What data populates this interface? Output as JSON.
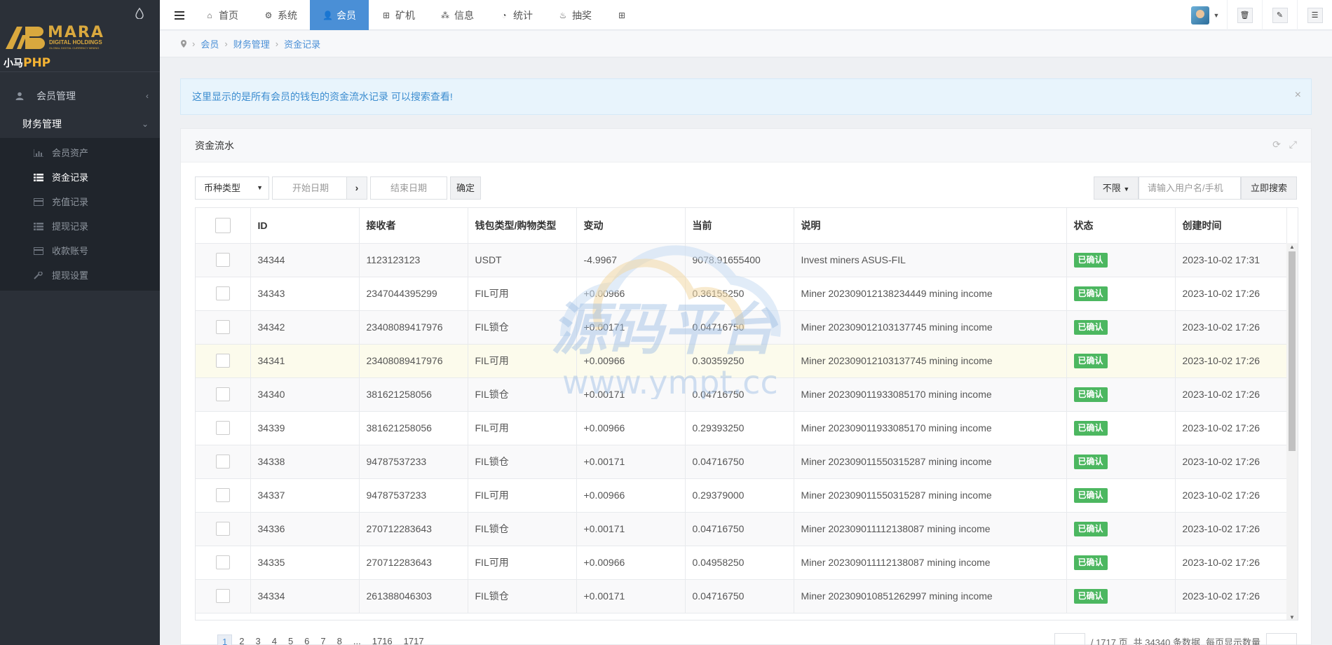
{
  "brand": {
    "logo_name": "MARA",
    "logo_sub": "DIGITAL HOLDINGS",
    "logo_sub2": "GLOBAL DIGITAL CURRENCY MINING",
    "product_prefix": "小马",
    "product_suffix": "PHP"
  },
  "sidebar": {
    "items": [
      {
        "label": "会员管理",
        "icon": "user-icon",
        "chevron": "‹"
      },
      {
        "label": "财务管理",
        "icon": "finance-icon",
        "chevron": "⌄"
      }
    ],
    "sub_items": [
      {
        "label": "会员资产",
        "icon": "bar-chart-icon"
      },
      {
        "label": "资金记录",
        "icon": "list-icon"
      },
      {
        "label": "充值记录",
        "icon": "card-icon"
      },
      {
        "label": "提现记录",
        "icon": "list-icon"
      },
      {
        "label": "收款账号",
        "icon": "card-icon"
      },
      {
        "label": "提现设置",
        "icon": "wrench-icon"
      }
    ]
  },
  "topnav": {
    "tabs": [
      {
        "label": "首页",
        "icon": "⌂"
      },
      {
        "label": "系统",
        "icon": "⚙"
      },
      {
        "label": "会员",
        "icon": "👤"
      },
      {
        "label": "矿机",
        "icon": "⊞"
      },
      {
        "label": "信息",
        "icon": "⁂"
      },
      {
        "label": "统计",
        "icon": "◔"
      },
      {
        "label": "抽奖",
        "icon": "♨"
      },
      {
        "label": "",
        "icon": "⊞"
      }
    ]
  },
  "breadcrumb": [
    "会员",
    "财务管理",
    "资金记录"
  ],
  "alert": {
    "text": "这里显示的是所有会员的钱包的资金流水记录 可以搜索查看!",
    "close": "×"
  },
  "panel": {
    "title": "资金流水",
    "filters": {
      "currency_select": "币种类型",
      "start_date_placeholder": "开始日期",
      "end_date_placeholder": "结束日期",
      "arrow": "›",
      "confirm": "确定",
      "scope_select": "不限",
      "search_placeholder": "请输入用户名/手机",
      "search_button": "立即搜索"
    },
    "columns": [
      "ID",
      "接收者",
      "钱包类型/购物类型",
      "变动",
      "当前",
      "说明",
      "状态",
      "创建时间"
    ],
    "rows": [
      [
        "34344",
        "1123123123",
        "USDT",
        "-4.9967",
        "9078.91655400",
        "Invest miners ASUS-FIL",
        "已确认",
        "2023-10-02 17:31"
      ],
      [
        "34343",
        "2347044395299",
        "FIL可用",
        "+0.00966",
        "0.36155250",
        "Miner 202309012138234449 mining income",
        "已确认",
        "2023-10-02 17:26"
      ],
      [
        "34342",
        "23408089417976",
        "FIL锁仓",
        "+0.00171",
        "0.04716750",
        "Miner 202309012103137745 mining income",
        "已确认",
        "2023-10-02 17:26"
      ],
      [
        "34341",
        "23408089417976",
        "FIL可用",
        "+0.00966",
        "0.30359250",
        "Miner 202309012103137745 mining income",
        "已确认",
        "2023-10-02 17:26"
      ],
      [
        "34340",
        "381621258056",
        "FIL锁仓",
        "+0.00171",
        "0.04716750",
        "Miner 202309011933085170 mining income",
        "已确认",
        "2023-10-02 17:26"
      ],
      [
        "34339",
        "381621258056",
        "FIL可用",
        "+0.00966",
        "0.29393250",
        "Miner 202309011933085170 mining income",
        "已确认",
        "2023-10-02 17:26"
      ],
      [
        "34338",
        "94787537233",
        "FIL锁仓",
        "+0.00171",
        "0.04716750",
        "Miner 202309011550315287 mining income",
        "已确认",
        "2023-10-02 17:26"
      ],
      [
        "34337",
        "94787537233",
        "FIL可用",
        "+0.00966",
        "0.29379000",
        "Miner 202309011550315287 mining income",
        "已确认",
        "2023-10-02 17:26"
      ],
      [
        "34336",
        "270712283643",
        "FIL锁仓",
        "+0.00171",
        "0.04716750",
        "Miner 202309011112138087 mining income",
        "已确认",
        "2023-10-02 17:26"
      ],
      [
        "34335",
        "270712283643",
        "FIL可用",
        "+0.00966",
        "0.04958250",
        "Miner 202309011112138087 mining income",
        "已确认",
        "2023-10-02 17:26"
      ],
      [
        "34334",
        "261388046303",
        "FIL锁仓",
        "+0.00171",
        "0.04716750",
        "Miner 202309010851262997 mining income",
        "已确认",
        "2023-10-02 17:26"
      ]
    ]
  },
  "pagination": {
    "pages": [
      "1",
      "2",
      "3",
      "4",
      "5",
      "6",
      "7",
      "8",
      "...",
      "1716",
      "1717"
    ],
    "total_pages_text": "/ 1717 页",
    "total_records_text": "共 34340 条数据",
    "per_page_label": "每页显示数量"
  },
  "watermark": {
    "title": "源码平台",
    "url": "www.ympt.cc"
  },
  "colors": {
    "accent": "#4a8fd6",
    "sidebar": "#2b3038",
    "success": "#4cb760",
    "brand_gold": "#d9a83e"
  }
}
